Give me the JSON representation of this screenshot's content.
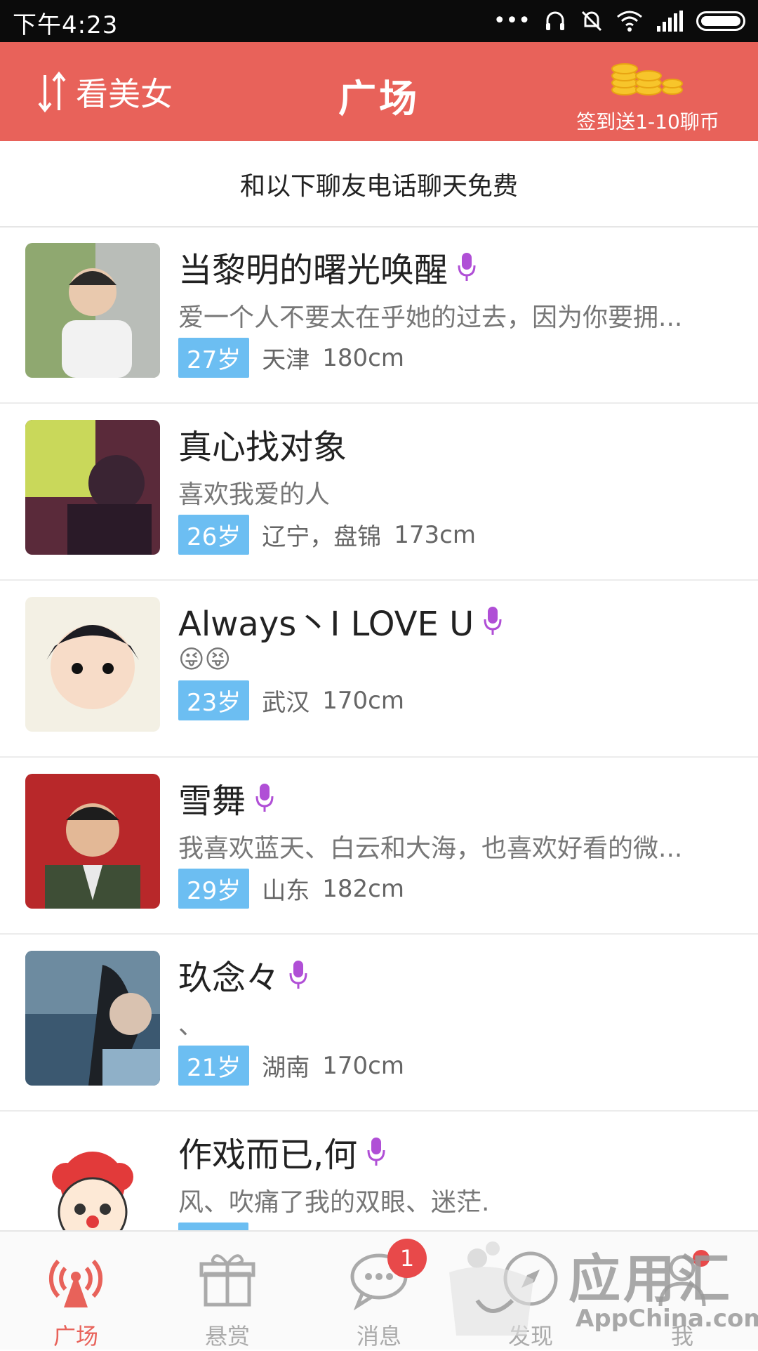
{
  "status_bar": {
    "time": "下午4:23",
    "icons": [
      "more-dots-icon",
      "headset-icon",
      "mute-icon",
      "wifi-icon",
      "signal-icon",
      "battery-icon"
    ]
  },
  "header": {
    "left_label": "看美女",
    "title": "广场",
    "right_label": "签到送1-10聊币",
    "bg_color": "#e8625a"
  },
  "notice": "和以下聊友电话聊天免费",
  "users": [
    {
      "name": "当黎明的曙光唤醒",
      "has_voice": true,
      "signature": "爱一个人不要太在乎她的过去，因为你要拥...",
      "age": "27岁",
      "location": "天津",
      "height": "180cm"
    },
    {
      "name": "真心找对象",
      "has_voice": false,
      "signature": "喜欢我爱的人",
      "age": "26岁",
      "location": "辽宁，盘锦",
      "height": "173cm"
    },
    {
      "name": "Always丶I LOVE U",
      "has_voice": true,
      "signature": "😜😝",
      "age": "23岁",
      "location": "武汉",
      "height": "170cm"
    },
    {
      "name": "雪舞",
      "has_voice": true,
      "signature": "我喜欢蓝天、白云和大海，也喜欢好看的微...",
      "age": "29岁",
      "location": "山东",
      "height": "182cm"
    },
    {
      "name": "玖念々",
      "has_voice": true,
      "signature": "、",
      "age": "21岁",
      "location": "湖南",
      "height": "170cm"
    },
    {
      "name": "作戏而已,何",
      "has_voice": true,
      "signature": "风、吹痛了我的双眼、迷茫.",
      "age": "",
      "location": "",
      "height": ""
    }
  ],
  "tabs": [
    {
      "label": "广场",
      "icon": "broadcast-icon",
      "active": true
    },
    {
      "label": "悬赏",
      "icon": "gift-icon",
      "active": false
    },
    {
      "label": "消息",
      "icon": "chat-icon",
      "active": false,
      "badge": "1"
    },
    {
      "label": "发现",
      "icon": "compass-icon",
      "active": false
    },
    {
      "label": "我",
      "icon": "person-icon",
      "active": false
    }
  ],
  "watermark": {
    "brand": "应用汇",
    "site": "AppChina.com"
  },
  "colors": {
    "accent": "#e8625a",
    "age_badge": "#6cbef2",
    "mic": "#b04fd6"
  }
}
